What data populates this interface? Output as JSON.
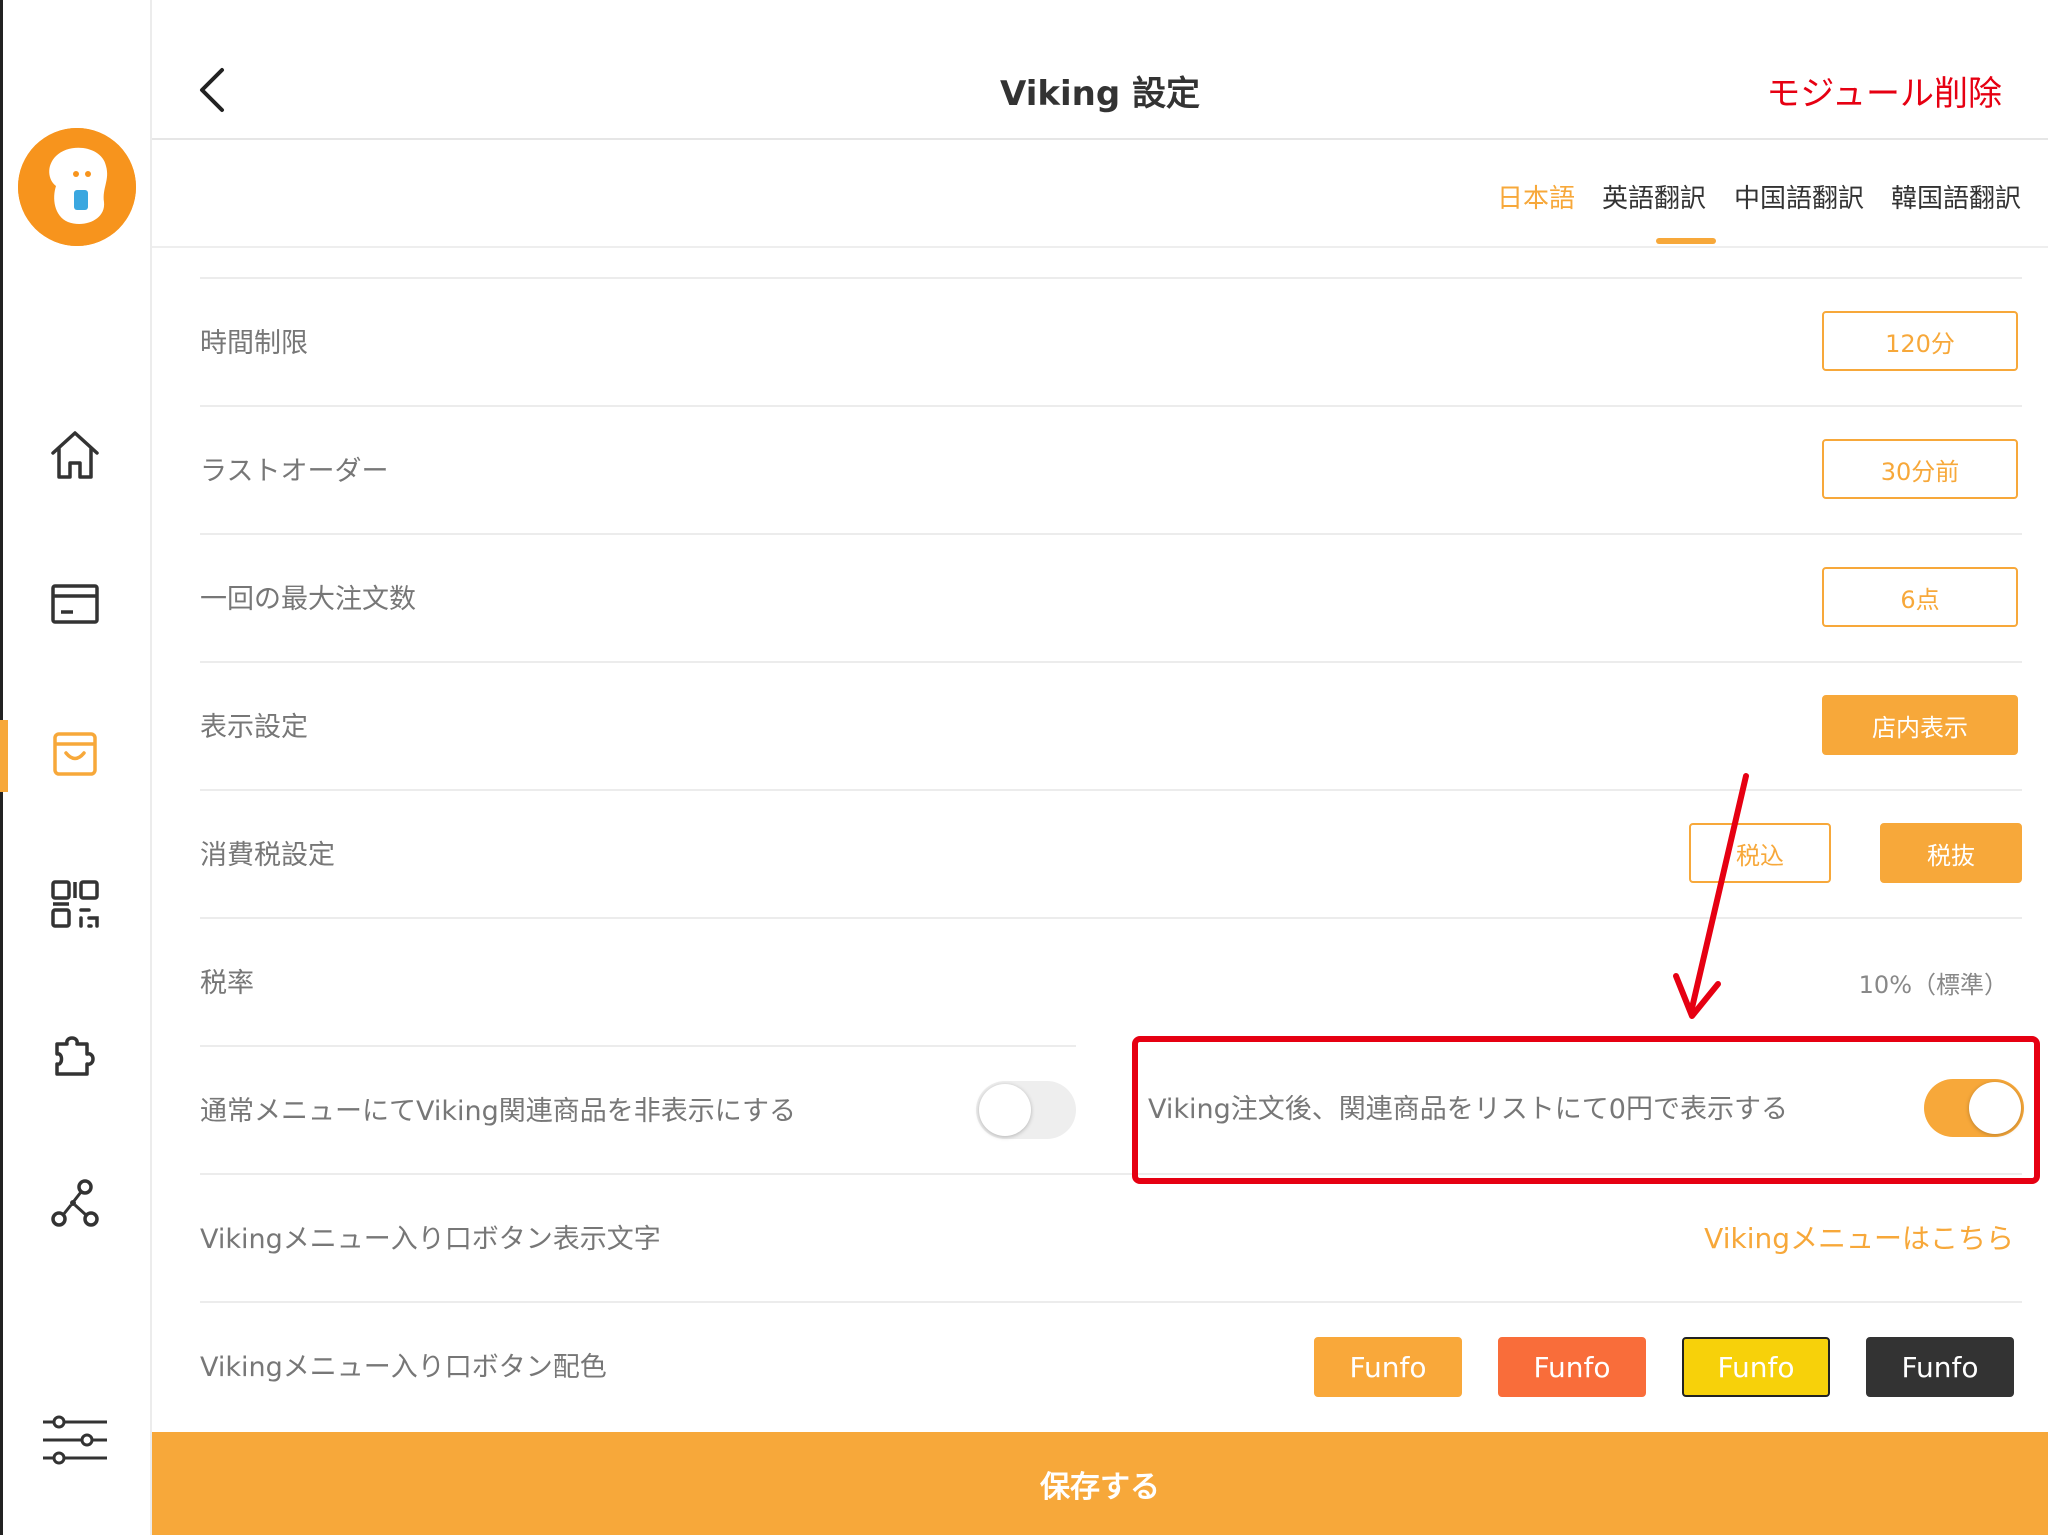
{
  "header": {
    "title": "Viking 設定",
    "delete_label": "モジュール削除"
  },
  "tabs": [
    {
      "label": "日本語",
      "active": true
    },
    {
      "label": "英語翻訳",
      "active": false
    },
    {
      "label": "中国語翻訳",
      "active": false
    },
    {
      "label": "韓国語翻訳",
      "active": false
    }
  ],
  "settings": {
    "time_limit": {
      "label": "時間制限",
      "value": "120分"
    },
    "last_order": {
      "label": "ラストオーダー",
      "value": "30分前"
    },
    "max_order": {
      "label": "一回の最大注文数",
      "value": "6点"
    },
    "display": {
      "label": "表示設定",
      "value": "店内表示"
    },
    "tax": {
      "label": "消費税設定",
      "option_incl": "税込",
      "option_excl": "税抜",
      "selected": "税抜"
    },
    "tax_rate": {
      "label": "税率",
      "value": "10%（標準）"
    },
    "hide_normal": {
      "label": "通常メニューにてViking関連商品を非表示にする",
      "enabled": false
    },
    "show_zero": {
      "label": "Viking注文後、関連商品をリストにて0円で表示する",
      "enabled": true
    },
    "entry_text": {
      "label": "Vikingメニュー入り口ボタン表示文字",
      "value": "Vikingメニューはこちら"
    },
    "entry_color": {
      "label": "Vikingメニュー入り口ボタン配色",
      "options": [
        {
          "text": "Funfo",
          "bg": "#f9a83a",
          "fg": "#ffffff",
          "border": "#f9a83a"
        },
        {
          "text": "Funfo",
          "bg": "#f96d3a",
          "fg": "#ffffff",
          "border": "#f96d3a"
        },
        {
          "text": "Funfo",
          "bg": "#f7d10a",
          "fg": "#ffffff",
          "border": "#222222"
        },
        {
          "text": "Funfo",
          "bg": "#333333",
          "fg": "#ffffff",
          "border": "#333333"
        }
      ]
    }
  },
  "footer": {
    "save_label": "保存する"
  },
  "sidebar": {
    "icons": [
      "home-icon",
      "card-icon",
      "shop-bag-icon",
      "qr-code-icon",
      "puzzle-icon",
      "network-icon",
      "sliders-icon"
    ],
    "active": "shop-bag-icon"
  },
  "colors": {
    "accent": "#f7a83a",
    "danger": "#e60012"
  }
}
